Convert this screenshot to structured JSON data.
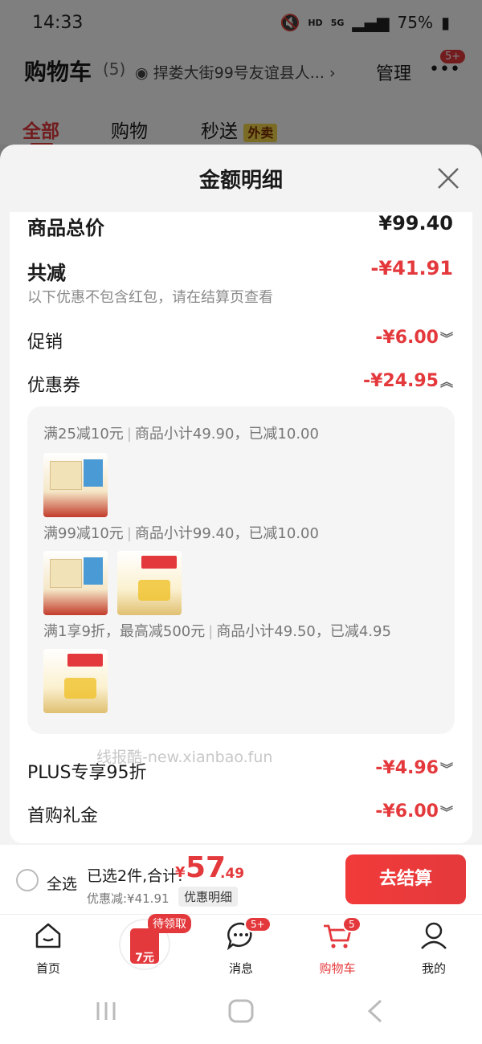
{
  "status_bar": {
    "time": "14:33",
    "network": "HD",
    "network2": "5G",
    "battery": "75%"
  },
  "cart": {
    "title": "购物车",
    "count": "(5)",
    "address": "捍娄大街99号友谊县人...",
    "manage": "管理",
    "more_badge": "5+"
  },
  "tabs": [
    {
      "label": "全部"
    },
    {
      "label": "购物"
    },
    {
      "label": "秒送"
    }
  ],
  "tab_tag": "外卖",
  "sheet": {
    "title": "金额明细",
    "total_label": "商品总价",
    "total_value": "¥99.40",
    "reduction_label": "共减",
    "reduction_value": "-¥41.91",
    "note": "以下优惠不包含红包，请在结算页查看",
    "promo_label": "促销",
    "promo_value": "-¥6.00",
    "coupon_label": "优惠券",
    "coupon_value": "-¥24.95",
    "coupon_lines": [
      {
        "title": "满25减10元",
        "detail": "商品小计49.90，已减10.00"
      },
      {
        "title": "满99减10元",
        "detail": "商品小计99.40，已减10.00"
      },
      {
        "title": "满1享9折，最高减500元",
        "detail": "商品小计49.50，已减4.95"
      }
    ],
    "watermark": "线报酷-new.xianbao.fun",
    "plus_label": "PLUS专享95折",
    "plus_value": "-¥4.96",
    "first_label": "首购礼金",
    "first_value": "-¥6.00"
  },
  "bottom": {
    "select_all": "全选",
    "summary": "已选2件,合计:",
    "price_yen": "¥",
    "price_int": "57",
    "price_dec": ".49",
    "discount": "优惠减:¥41.91",
    "detail_button": "优惠明细",
    "checkout": "去结算"
  },
  "nav": [
    {
      "label": "首页"
    },
    {
      "label": ""
    },
    {
      "label": "消息",
      "badge": "5+"
    },
    {
      "label": "购物车",
      "badge": "5"
    },
    {
      "label": "我的"
    }
  ],
  "redpack": {
    "pill": "待领取",
    "amount": "7元"
  }
}
